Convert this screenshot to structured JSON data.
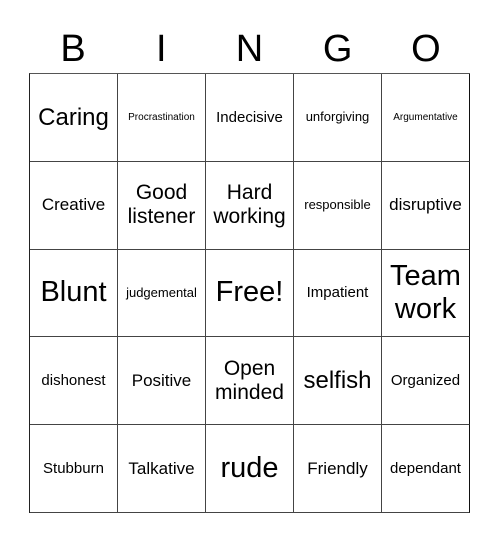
{
  "header": [
    "B",
    "I",
    "N",
    "G",
    "O"
  ],
  "cells": [
    {
      "text": "Caring",
      "size": "s-xxl"
    },
    {
      "text": "Procrastination",
      "size": "s-xs"
    },
    {
      "text": "Indecisive",
      "size": "s-m"
    },
    {
      "text": "unforgiving",
      "size": "s-s"
    },
    {
      "text": "Argumentative",
      "size": "s-xs"
    },
    {
      "text": "Creative",
      "size": "s-l"
    },
    {
      "text": "Good listener",
      "size": "s-xl"
    },
    {
      "text": "Hard working",
      "size": "s-xl"
    },
    {
      "text": "responsible",
      "size": "s-s"
    },
    {
      "text": "disruptive",
      "size": "s-l"
    },
    {
      "text": "Blunt",
      "size": "s-h"
    },
    {
      "text": "judgemental",
      "size": "s-s"
    },
    {
      "text": "Free!",
      "size": "s-h"
    },
    {
      "text": "Impatient",
      "size": "s-m"
    },
    {
      "text": "Team work",
      "size": "s-h"
    },
    {
      "text": "dishonest",
      "size": "s-m"
    },
    {
      "text": "Positive",
      "size": "s-l"
    },
    {
      "text": "Open minded",
      "size": "s-xl"
    },
    {
      "text": "selfish",
      "size": "s-xxl"
    },
    {
      "text": "Organized",
      "size": "s-m"
    },
    {
      "text": "Stubburn",
      "size": "s-m"
    },
    {
      "text": "Talkative",
      "size": "s-l"
    },
    {
      "text": "rude",
      "size": "s-h"
    },
    {
      "text": "Friendly",
      "size": "s-l"
    },
    {
      "text": "dependant",
      "size": "s-m"
    }
  ]
}
